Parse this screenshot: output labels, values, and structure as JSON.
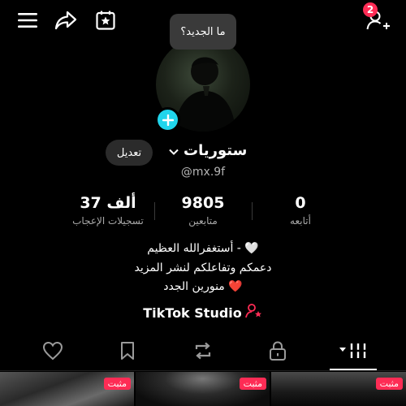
{
  "header": {
    "menu_icon": "hamburger-menu-icon",
    "share_icon": "share-arrow-icon",
    "calendar_icon": "star-calendar-icon",
    "add_friend_icon": "add-friend-icon",
    "friend_request_count": "2"
  },
  "profile": {
    "whats_new_bubble": "ما الجديد؟",
    "name": "ستوريات",
    "username": "@mx.9f",
    "edit_label": "تعديل"
  },
  "stats": [
    {
      "value": "0",
      "label": "أتابعه"
    },
    {
      "value": "9805",
      "label": "متابعين"
    },
    {
      "value": "37 ألف",
      "label": "تسجيلات الإعجاب"
    }
  ],
  "bio": [
    "أستغفرالله العظيم - 🤍",
    "دعمكم وتفاعلكم لنشر المزيد",
    "منورين الجدد ❤️"
  ],
  "studio_label": "TikTok Studio",
  "tabs": [
    {
      "icon": "videos-grid-icon"
    },
    {
      "icon": "lock-icon"
    },
    {
      "icon": "repost-icon"
    },
    {
      "icon": "bookmark-icon"
    },
    {
      "icon": "heart-icon"
    }
  ],
  "thumbnails": [
    {
      "pinned_label": "مثبت"
    },
    {
      "pinned_label": "مثبت"
    },
    {
      "pinned_label": "مثبت"
    }
  ],
  "colors": {
    "accent": "#fe2c55",
    "avatar_plus": "#20d5ec",
    "background": "#000000"
  }
}
